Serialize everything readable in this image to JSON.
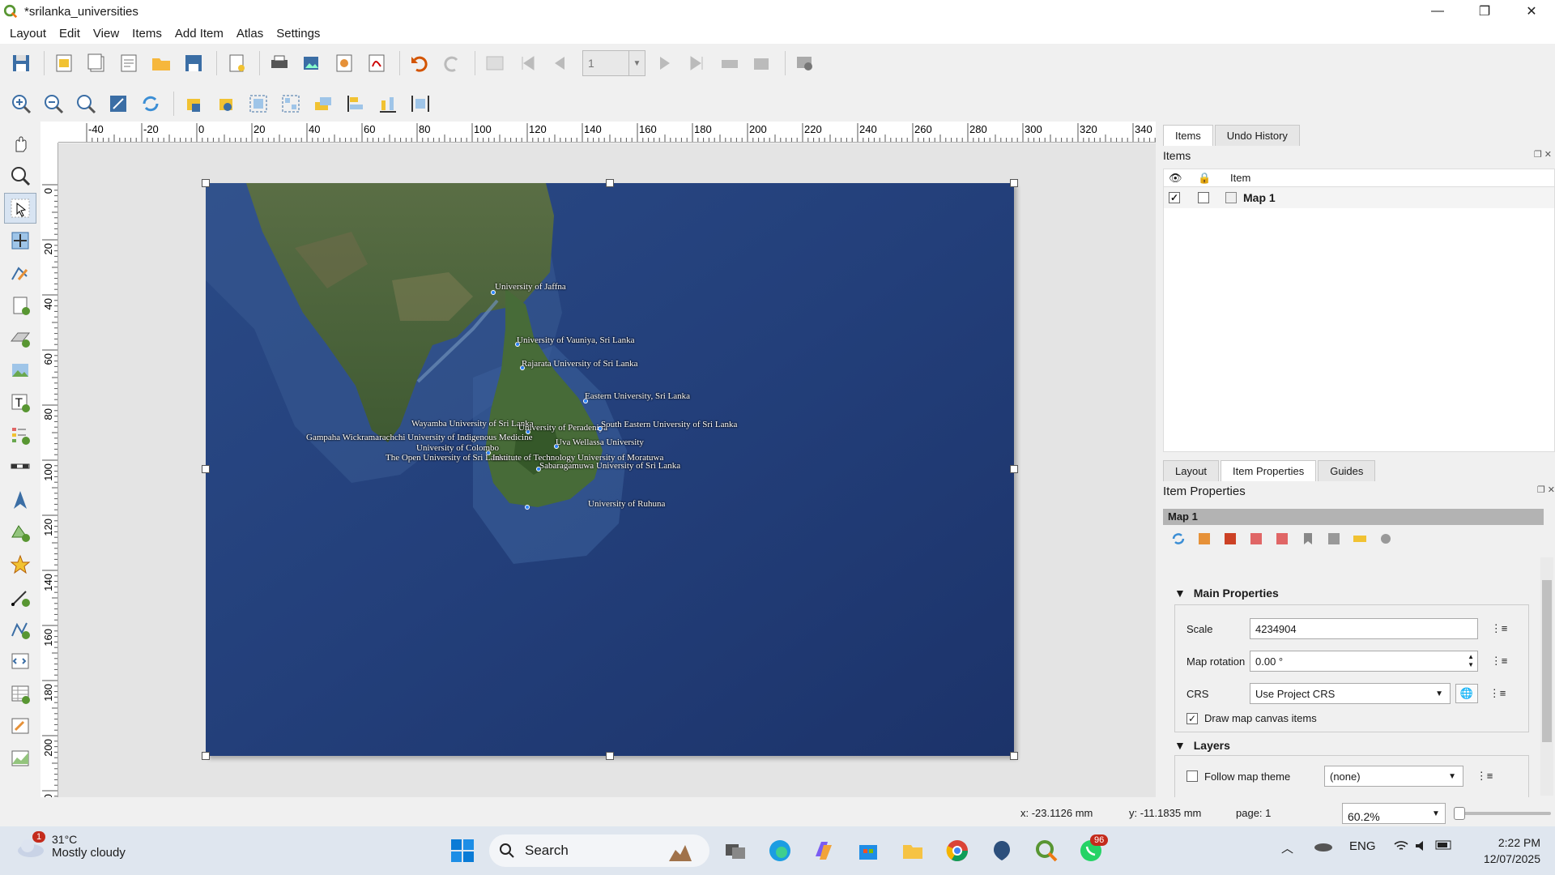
{
  "window": {
    "title": "*srilanka_universities"
  },
  "menu": [
    "Layout",
    "Edit",
    "View",
    "Items",
    "Add Item",
    "Atlas",
    "Settings"
  ],
  "toolbar": {
    "page_number": "1"
  },
  "ruler": {
    "h_ticks": [
      "-40",
      "-20",
      "0",
      "20",
      "40",
      "60",
      "80",
      "100",
      "120",
      "140",
      "160",
      "180",
      "200",
      "220",
      "240",
      "260",
      "280",
      "300",
      "320",
      "340"
    ],
    "v_ticks": [
      "0",
      "20",
      "40",
      "60",
      "80",
      "100",
      "120",
      "140",
      "160",
      "180",
      "200",
      "20"
    ]
  },
  "map": {
    "labels": [
      "University of Jaffna",
      "University of Vauniya, Sri Lanka",
      "Rajarata University of Sri Lanka",
      "Eastern University, Sri Lanka",
      "Wayamba University of Sri Lanka",
      "University of Peradeniya",
      "South Eastern University of Sri Lanka",
      "Gampaha Wickramarachchi University of Indigenous Medicine",
      "Uva Wellassa University",
      "University of Colombo",
      "The Open University of Sri Lanka",
      "Institute of Technology University of Moratuwa",
      "Sabaragamuwa University of Sri Lanka",
      "University of Ruhuna"
    ]
  },
  "right_panel": {
    "top_tabs": [
      "Items",
      "Undo History"
    ],
    "items_title": "Items",
    "items_col_header": "Item",
    "items_rows": [
      {
        "name": "Map 1",
        "visible": true,
        "locked": false
      }
    ],
    "bottom_tabs": [
      "Layout",
      "Item Properties",
      "Guides"
    ],
    "props_title": "Item Properties",
    "selected_item": "Map 1",
    "main_properties_label": "Main Properties",
    "scale_label": "Scale",
    "scale_value": "4234904",
    "rotation_label": "Map rotation",
    "rotation_value": "0.00 °",
    "crs_label": "CRS",
    "crs_value": "Use Project CRS",
    "draw_canvas_items_label": "Draw map canvas items",
    "layers_label": "Layers",
    "follow_theme_label": "Follow map theme",
    "follow_theme_value": "(none)"
  },
  "status": {
    "x": "x: -23.1126 mm",
    "y": "y: -11.1835 mm",
    "page": "page: 1",
    "zoom": "60.2%"
  },
  "taskbar": {
    "weather_badge": "1",
    "temp": "31°C",
    "weather": "Mostly cloudy",
    "search": "Search",
    "whatsapp_badge": "96",
    "lang": "ENG",
    "time": "2:22 PM",
    "date": "12/07/2025"
  }
}
